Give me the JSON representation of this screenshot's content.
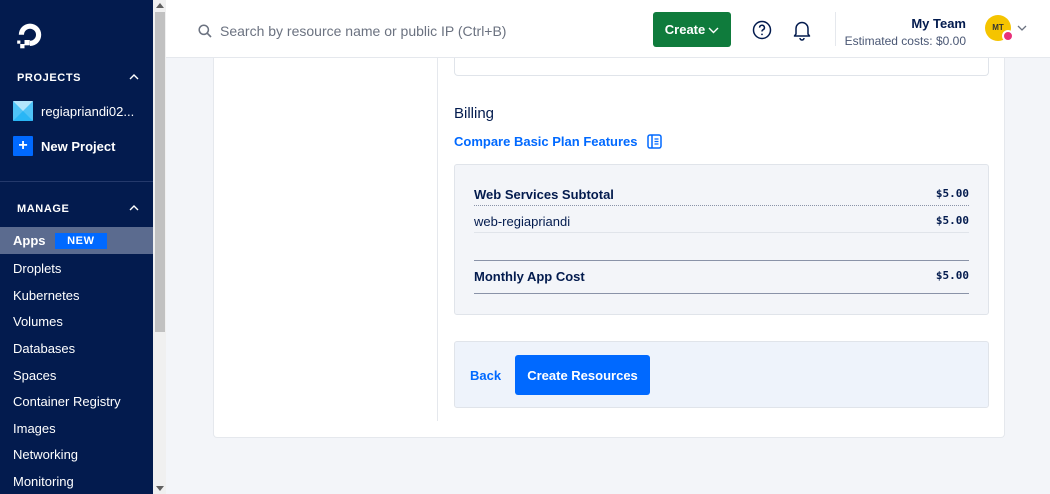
{
  "sidebar": {
    "projects_heading": "PROJECTS",
    "project_name": "regiapriandi02...",
    "new_project_label": "New Project",
    "manage_heading": "MANAGE",
    "new_badge": "NEW",
    "items": [
      {
        "label": "Apps",
        "active": true
      },
      {
        "label": "Droplets"
      },
      {
        "label": "Kubernetes"
      },
      {
        "label": "Volumes"
      },
      {
        "label": "Databases"
      },
      {
        "label": "Spaces"
      },
      {
        "label": "Container Registry"
      },
      {
        "label": "Images"
      },
      {
        "label": "Networking"
      },
      {
        "label": "Monitoring"
      }
    ]
  },
  "topbar": {
    "search_placeholder": "Search by resource name or public IP (Ctrl+B)",
    "create_label": "Create",
    "team_name": "My Team",
    "estimated_costs": "Estimated costs: $0.00",
    "avatar_initials": "MT"
  },
  "billing": {
    "title": "Billing",
    "compare_link": "Compare Basic Plan Features",
    "subtotal_label": "Web Services Subtotal",
    "subtotal_amount": "$5.00",
    "service_name": "web-regiapriandi",
    "service_amount": "$5.00",
    "monthly_label": "Monthly App Cost",
    "monthly_amount": "$5.00"
  },
  "actions": {
    "back_label": "Back",
    "create_resources_label": "Create Resources"
  },
  "colors": {
    "sidebar_bg": "#031b4e",
    "accent": "#0069ff",
    "create_green": "#0f7b3c"
  }
}
